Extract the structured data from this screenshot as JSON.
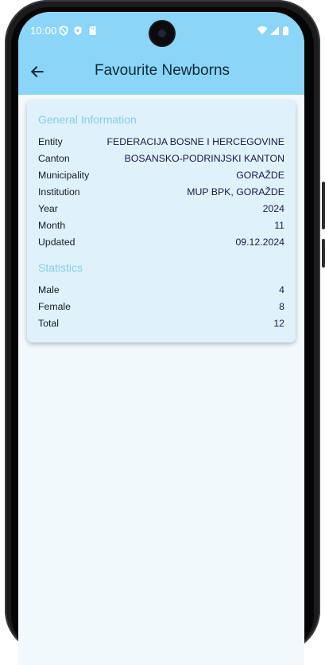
{
  "status_bar": {
    "time": "10:00",
    "icons_left": [
      "shield-icon",
      "badge-icon",
      "sd-card-icon"
    ],
    "icons_right": [
      "wifi-icon",
      "signal-icon",
      "battery-icon"
    ]
  },
  "colors": {
    "app_bar": "#8ad5f8",
    "background": "#f2f9fd",
    "card": "#dff2fb",
    "section_title": "#83cde9"
  },
  "header": {
    "title": "Favourite Newborns",
    "back_icon": "arrow-left-icon"
  },
  "general": {
    "title": "General Information",
    "rows": [
      {
        "label": "Entity",
        "value": "FEDERACIJA BOSNE I HERCEGOVINE"
      },
      {
        "label": "Canton",
        "value": "BOSANSKO-PODRINJSKI KANTON"
      },
      {
        "label": "Municipality",
        "value": "GORAŽDE"
      },
      {
        "label": "Institution",
        "value": "MUP BPK, GORAŽDE"
      },
      {
        "label": "Year",
        "value": "2024"
      },
      {
        "label": "Month",
        "value": "11"
      },
      {
        "label": "Updated",
        "value": "09.12.2024"
      }
    ]
  },
  "statistics": {
    "title": "Statistics",
    "rows": [
      {
        "label": "Male",
        "value": "4"
      },
      {
        "label": "Female",
        "value": "8"
      },
      {
        "label": "Total",
        "value": "12"
      }
    ]
  }
}
